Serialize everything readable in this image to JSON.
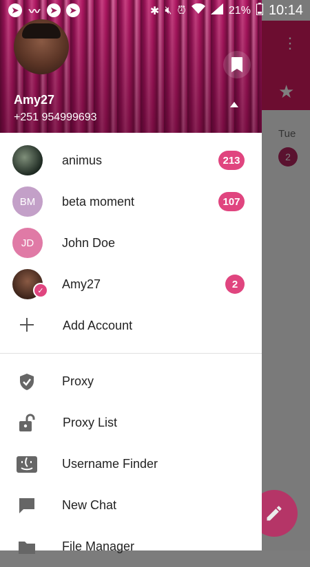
{
  "status_bar": {
    "battery": "21%",
    "time": "10:14",
    "left_icons": [
      "telegram-icon",
      "signal-app-icon",
      "telegram-icon",
      "telegram-icon"
    ]
  },
  "background": {
    "day_label": "Tue",
    "badge_count": "2"
  },
  "drawer": {
    "user_name": "Amy27",
    "user_phone": "+251 954999693",
    "accounts": [
      {
        "name": "animus",
        "initials": "",
        "count": "213",
        "avatar_color": "#1e2a22"
      },
      {
        "name": "beta moment",
        "initials": "BM",
        "count": "107",
        "avatar_color": "#c3a0c8"
      },
      {
        "name": "John Doe",
        "initials": "JD",
        "count": "",
        "avatar_color": "#e07aa6"
      },
      {
        "name": "Amy27",
        "initials": "",
        "count": "2",
        "avatar_color": "#6b4a3a"
      }
    ],
    "add_account_label": "Add Account",
    "menu": [
      {
        "label": "Proxy",
        "icon": "shield-check-icon"
      },
      {
        "label": "Proxy List",
        "icon": "unlock-icon"
      },
      {
        "label": "Username Finder",
        "icon": "finder-icon"
      },
      {
        "label": "New Chat",
        "icon": "chat-icon"
      },
      {
        "label": "File Manager",
        "icon": "folder-icon"
      }
    ]
  },
  "colors": {
    "accent": "#e0457f",
    "header": "#b3185e"
  }
}
